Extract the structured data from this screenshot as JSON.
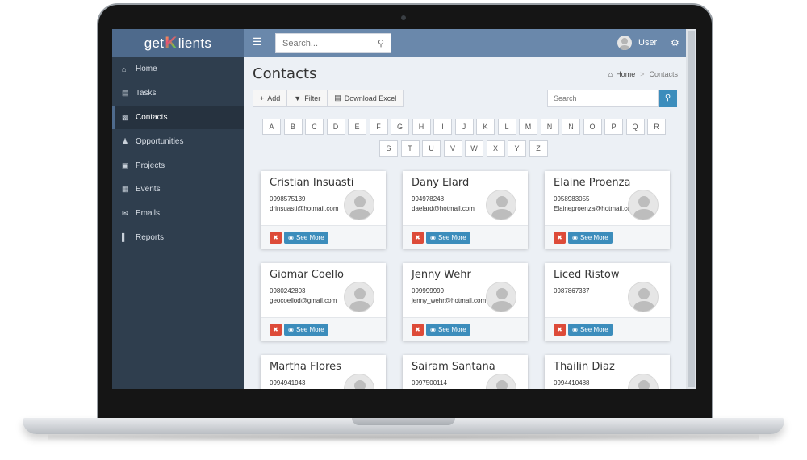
{
  "app": {
    "logo_left": "get",
    "logo_k": "K",
    "logo_right": "lients"
  },
  "header": {
    "menu_icon": "hamburger-icon",
    "search_placeholder": "Search...",
    "user_label": "User",
    "settings_icon": "gear-icon"
  },
  "sidebar": {
    "items": [
      {
        "label": "Home",
        "icon": "home-icon"
      },
      {
        "label": "Tasks",
        "icon": "tasks-icon"
      },
      {
        "label": "Contacts",
        "icon": "contacts-icon",
        "active": true
      },
      {
        "label": "Opportunities",
        "icon": "opportunities-icon"
      },
      {
        "label": "Projects",
        "icon": "briefcase-icon"
      },
      {
        "label": "Events",
        "icon": "calendar-icon"
      },
      {
        "label": "Emails",
        "icon": "envelope-icon"
      },
      {
        "label": "Reports",
        "icon": "bar-chart-icon"
      }
    ]
  },
  "page": {
    "title": "Contacts",
    "breadcrumb": {
      "home": "Home",
      "separator": ">",
      "current": "Contacts"
    },
    "actions": {
      "add": "Add",
      "filter": "Filter",
      "download": "Download Excel"
    },
    "search_placeholder": "Search"
  },
  "alphabet": {
    "row1": [
      "A",
      "B",
      "C",
      "D",
      "E",
      "F",
      "G",
      "H",
      "I",
      "J",
      "K",
      "L",
      "M",
      "N",
      "Ñ",
      "O",
      "P",
      "Q",
      "R"
    ],
    "row2": [
      "S",
      "T",
      "U",
      "V",
      "W",
      "X",
      "Y",
      "Z"
    ]
  },
  "card_actions": {
    "see_more": "See More"
  },
  "contacts": [
    {
      "name": "Cristian Insuasti",
      "phone": "0998575139",
      "email": "drinsuasti@hotmail.com"
    },
    {
      "name": "Dany Elard",
      "phone": "994978248",
      "email": "daelard@hotmail.com"
    },
    {
      "name": "Elaine Proenza",
      "phone": "0958983055",
      "email": "Elaineproenza@hotmail.com"
    },
    {
      "name": "Giomar Coello",
      "phone": "0980242803",
      "email": "geocoellod@gmail.com"
    },
    {
      "name": "Jenny Wehr",
      "phone": "099999999",
      "email": "jenny_wehr@hotmail.com"
    },
    {
      "name": "Liced Ristow",
      "phone": "0987867337",
      "email": ""
    },
    {
      "name": "Martha Flores",
      "phone": "0994941943",
      "email": ""
    },
    {
      "name": "Sairam Santana",
      "phone": "0997500114",
      "email": ""
    },
    {
      "name": "Thailin Diaz",
      "phone": "0994410488",
      "email": ""
    }
  ]
}
